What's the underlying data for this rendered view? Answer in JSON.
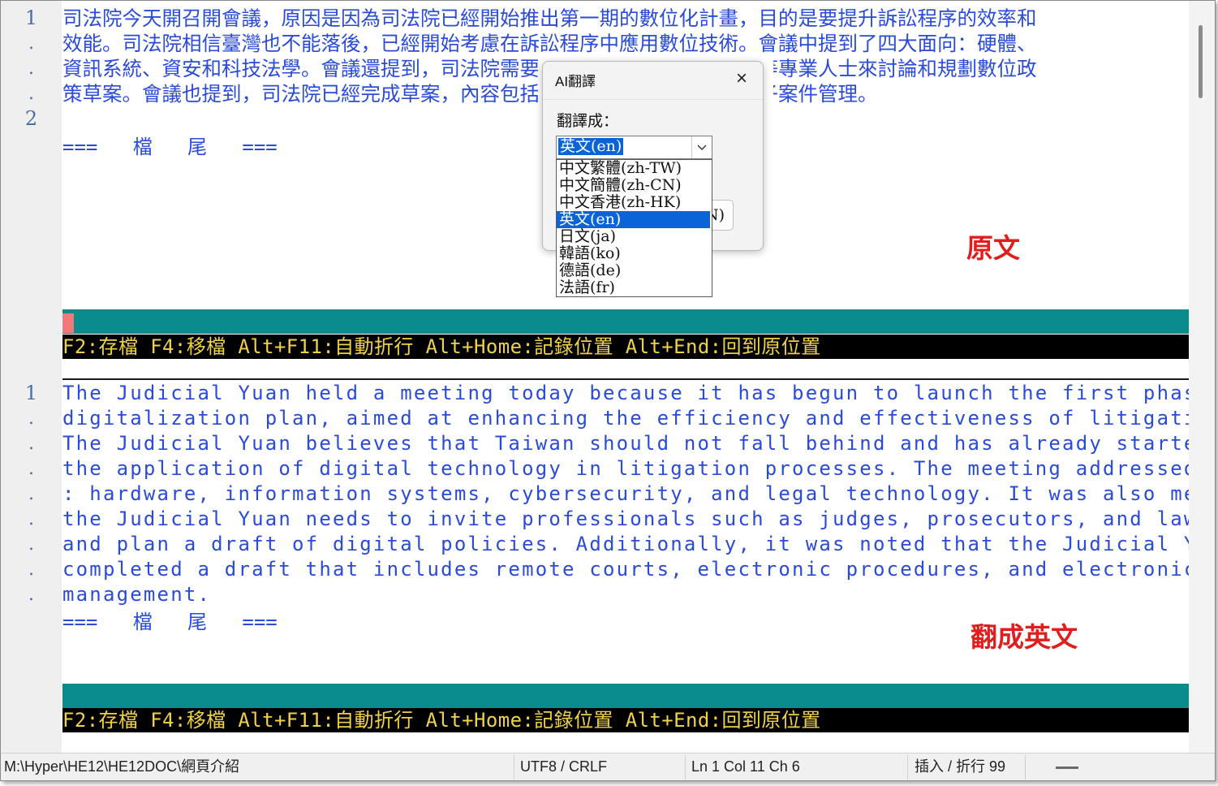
{
  "editor": {
    "top_line_numbers": [
      "1",
      ".",
      ".",
      ".",
      "2"
    ],
    "bottom_line_numbers": [
      "1",
      ".",
      ".",
      ".",
      ".",
      ".",
      ".",
      ".",
      ".",
      "."
    ],
    "original_lines": [
      "司法院今天開召開會議，原因是因為司法院已經開始推出第一期的數位化計畫，目的是要提升訴訟程序的效率和",
      "效能。司法院相信臺灣也不能落後，已經開始考慮在訴訟程序中應用數位技術。會議中提到了四大面向：硬體、",
      "資訊系統、資安和科技法學。會議還提到，司法院需要邀請法官、檢察官、律師等專業人士來討論和規劃數位政",
      "策草案。會議也提到，司法院已經完成草案，內容包括遠距法庭、電子程序和電子案件管理。"
    ],
    "eof_marker": "===   檔   尾   ===",
    "translated_lines": [
      "The Judicial Yuan held a meeting today because it has begun to launch the first phase of its",
      "digitalization plan, aimed at enhancing the efficiency and effectiveness of litigation procedures.",
      "The Judicial Yuan believes that Taiwan should not fall behind and has already started considering",
      "the application of digital technology in litigation processes. The meeting addressed four key areas",
      ": hardware, information systems, cybersecurity, and legal technology. It was also mentioned that",
      "the Judicial Yuan needs to invite professionals such as judges, prosecutors, and lawyers to discuss",
      " and plan a draft of digital policies. Additionally, it was noted that the Judicial Yuan has",
      "completed a draft that includes remote courts, electronic procedures, and electronic case",
      "management."
    ],
    "fkey_bar": "F2:存檔 F4:移檔 Alt+F11:自動折行 Alt+Home:記錄位置 Alt+End:回到原位置",
    "label_original": "原文",
    "label_translated": "翻成英文"
  },
  "dialog": {
    "title": "AI翻譯",
    "close": "×",
    "prompt": "翻譯成：",
    "selected": "英文(en)",
    "ok_partial": "N)",
    "options": [
      "中文繁體(zh-TW)",
      "中文簡體(zh-CN)",
      "中文香港(zh-HK)",
      "英文(en)",
      "日文(ja)",
      "韓語(ko)",
      "德語(de)",
      "法語(fr)"
    ],
    "selected_index": 3
  },
  "statusbar": {
    "path": "M:\\Hyper\\HE12\\HE12DOC\\網頁介紹",
    "encoding": "UTF8 / CRLF",
    "position": "Ln 1  Col 11  Ch 6",
    "mode": "插入 / 折行 99"
  },
  "colors": {
    "text_blue": "#2a4bd7",
    "teal_bar": "#0b8c8c",
    "fkey_text": "#f0d14a",
    "label_red": "#e01e1e",
    "selection_blue": "#0a64d8"
  }
}
